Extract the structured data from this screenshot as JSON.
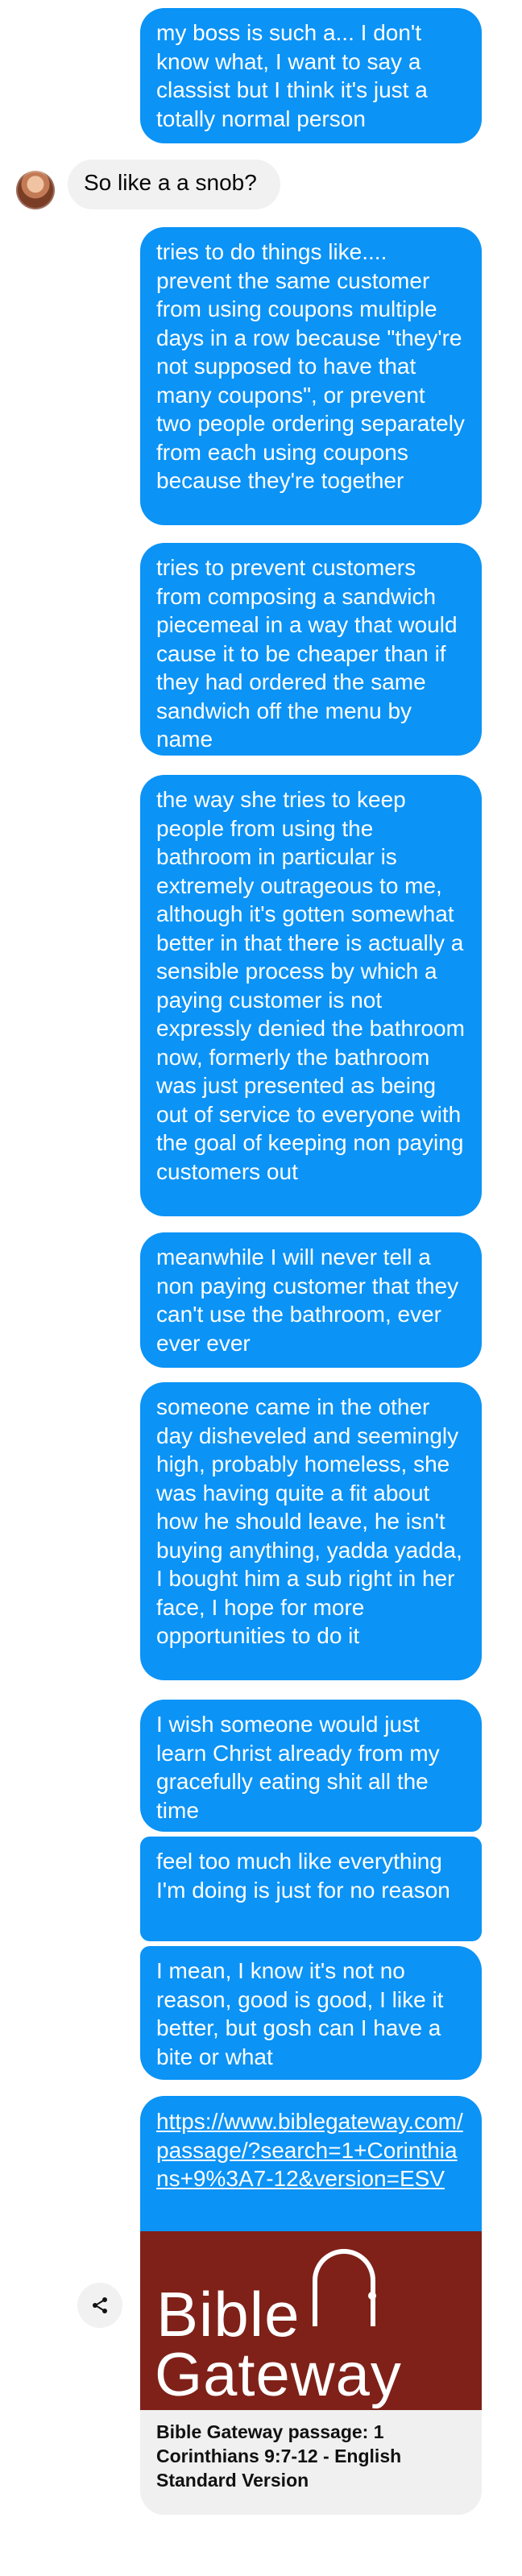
{
  "conversation": {
    "messages": [
      {
        "side": "sent",
        "text": "my boss is such a... I don't know what, I want to say a classist but I think it's just a totally normal person"
      },
      {
        "side": "received",
        "text": "So like a a snob?"
      },
      {
        "side": "sent",
        "text": "tries to do things like.... prevent the same customer from using coupons multiple days in a row because \"they're not supposed to have that many coupons\", or prevent two people ordering separately from each using coupons because they're together"
      },
      {
        "side": "sent",
        "text": "tries to prevent customers from composing a sandwich piecemeal in a way that would cause it to be cheaper than if they had ordered the same sandwich off the menu by name"
      },
      {
        "side": "sent",
        "text": "the way she tries to keep people from using the bathroom in particular is extremely outrageous to me, although it's gotten somewhat better in that there is actually a sensible process by which a paying customer is not expressly denied the bathroom now, formerly the bathroom was just presented as being out of service to everyone with the goal of keeping non paying customers out"
      },
      {
        "side": "sent",
        "text": "meanwhile I will never tell a non paying customer that they can't use the bathroom, ever ever ever"
      },
      {
        "side": "sent",
        "text": "someone came in the other day disheveled and seemingly high, probably homeless, she was having quite a fit about how he should leave, he isn't buying anything, yadda yadda, I bought him a sub right in her face, I hope for more opportunities to do it"
      },
      {
        "side": "sent",
        "text": "I wish someone would just learn Christ already from my gracefully eating shit all the time"
      },
      {
        "side": "sent",
        "text": "feel too much like everything I'm doing is just for no reason"
      },
      {
        "side": "sent",
        "text": "I mean, I know it's not no reason, good is good, I like it better, but gosh can I have a bite or what"
      }
    ]
  },
  "link_preview": {
    "url": "https://www.biblegateway.com/passage/?search=1+Corinthians+9%3A7-12&version=ESV",
    "image_logo_line1": "Bible",
    "image_logo_line2": "Gateway",
    "caption": "Bible Gateway passage: 1 Corinthians 9:7-12 - English Standard Version"
  },
  "share_button": {
    "icon": "share-icon"
  },
  "colors": {
    "sent_bubble": "#0b93f6",
    "received_bubble": "#f1f1f1",
    "bible_gateway_maroon": "#7f2118"
  }
}
